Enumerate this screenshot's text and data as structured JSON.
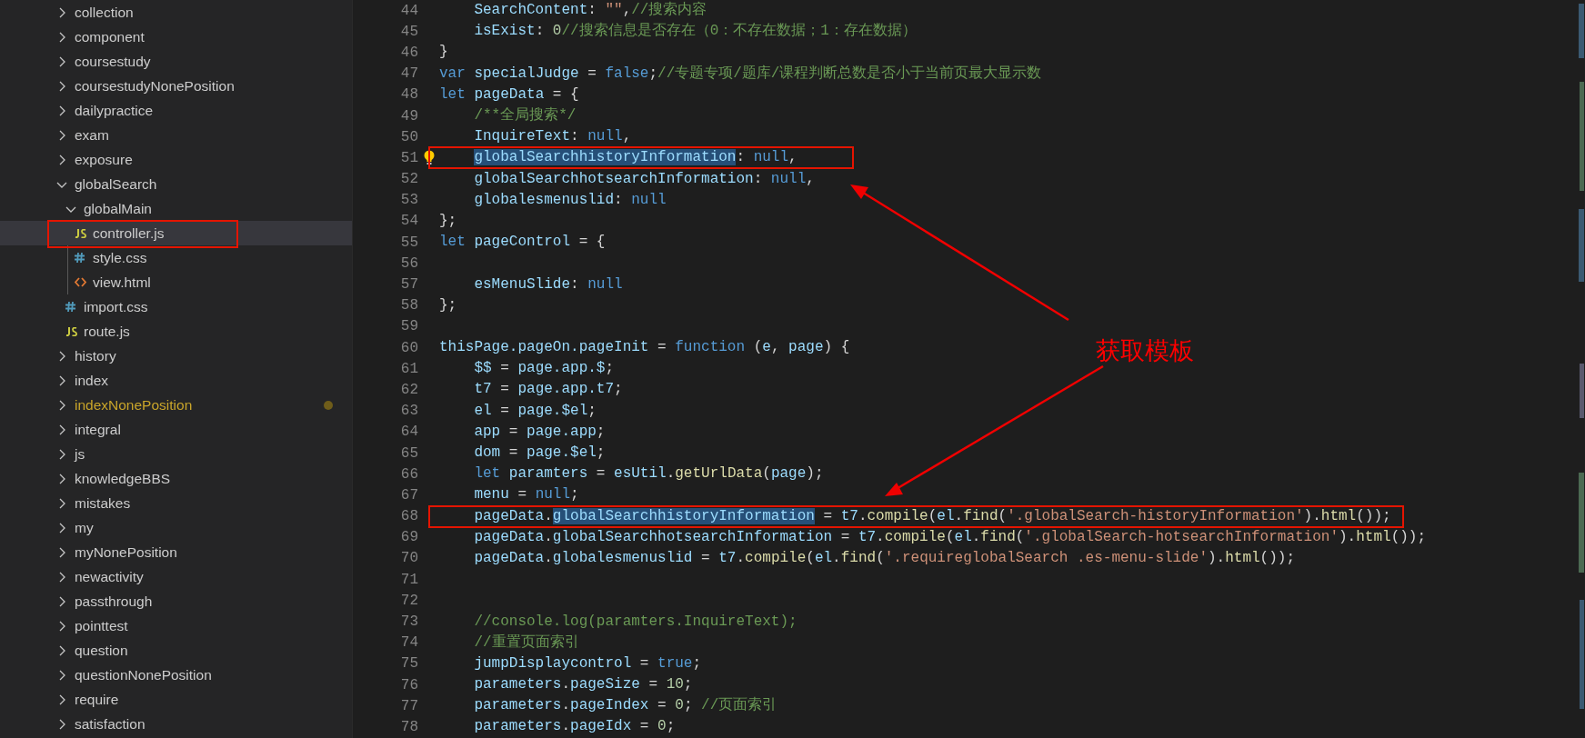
{
  "explorer": {
    "items": [
      {
        "label": "collection",
        "kind": "folder",
        "expanded": false,
        "selected": false
      },
      {
        "label": "component",
        "kind": "folder",
        "expanded": false,
        "selected": false
      },
      {
        "label": "coursestudy",
        "kind": "folder",
        "expanded": false,
        "selected": false
      },
      {
        "label": "coursestudyNonePosition",
        "kind": "folder",
        "expanded": false,
        "selected": false
      },
      {
        "label": "dailypractice",
        "kind": "folder",
        "expanded": false,
        "selected": false
      },
      {
        "label": "exam",
        "kind": "folder",
        "expanded": false,
        "selected": false
      },
      {
        "label": "exposure",
        "kind": "folder",
        "expanded": false,
        "selected": false
      },
      {
        "label": "globalSearch",
        "kind": "folder",
        "expanded": true,
        "selected": false,
        "children": [
          {
            "label": "globalMain",
            "kind": "folder",
            "expanded": true,
            "selected": false,
            "children": [
              {
                "label": "controller.js",
                "kind": "js",
                "selected": true,
                "boxed": true
              },
              {
                "label": "style.css",
                "kind": "css",
                "selected": false
              },
              {
                "label": "view.html",
                "kind": "html",
                "selected": false
              }
            ]
          },
          {
            "label": "import.css",
            "kind": "css",
            "selected": false
          },
          {
            "label": "route.js",
            "kind": "js",
            "selected": false
          }
        ]
      },
      {
        "label": "history",
        "kind": "folder",
        "expanded": false,
        "selected": false
      },
      {
        "label": "index",
        "kind": "folder",
        "expanded": false,
        "selected": false
      },
      {
        "label": "indexNonePosition",
        "kind": "folder",
        "expanded": false,
        "selected": false,
        "modified": true
      },
      {
        "label": "integral",
        "kind": "folder",
        "expanded": false,
        "selected": false
      },
      {
        "label": "js",
        "kind": "folder",
        "expanded": false,
        "selected": false
      },
      {
        "label": "knowledgeBBS",
        "kind": "folder",
        "expanded": false,
        "selected": false
      },
      {
        "label": "mistakes",
        "kind": "folder",
        "expanded": false,
        "selected": false
      },
      {
        "label": "my",
        "kind": "folder",
        "expanded": false,
        "selected": false
      },
      {
        "label": "myNonePosition",
        "kind": "folder",
        "expanded": false,
        "selected": false
      },
      {
        "label": "newactivity",
        "kind": "folder",
        "expanded": false,
        "selected": false
      },
      {
        "label": "passthrough",
        "kind": "folder",
        "expanded": false,
        "selected": false
      },
      {
        "label": "pointtest",
        "kind": "folder",
        "expanded": false,
        "selected": false
      },
      {
        "label": "question",
        "kind": "folder",
        "expanded": false,
        "selected": false
      },
      {
        "label": "questionNonePosition",
        "kind": "folder",
        "expanded": false,
        "selected": false
      },
      {
        "label": "require",
        "kind": "folder",
        "expanded": false,
        "selected": false
      },
      {
        "label": "satisfaction",
        "kind": "folder",
        "expanded": false,
        "selected": false
      }
    ]
  },
  "editor": {
    "lines": [
      {
        "n": "44",
        "tokens": [
          {
            "t": "    SearchContent",
            "kind": "var"
          },
          {
            "t": ": ",
            "kind": "pl"
          },
          {
            "t": "\"\"",
            "kind": "str"
          },
          {
            "t": ",",
            "kind": "pl"
          },
          {
            "t": "//搜索内容",
            "kind": "cmt"
          }
        ]
      },
      {
        "n": "45",
        "tokens": [
          {
            "t": "    isExist",
            "kind": "var"
          },
          {
            "t": ": ",
            "kind": "pl"
          },
          {
            "t": "0",
            "kind": "num"
          },
          {
            "t": "//搜索信息是否存在（0：不存在数据；1：存在数据）",
            "kind": "cmt"
          }
        ]
      },
      {
        "n": "46",
        "tokens": [
          {
            "t": "}",
            "kind": "pl"
          }
        ]
      },
      {
        "n": "47",
        "tokens": [
          {
            "t": "var",
            "kind": "kw"
          },
          {
            "t": " specialJudge ",
            "kind": "var"
          },
          {
            "t": "= ",
            "kind": "pl"
          },
          {
            "t": "false",
            "kind": "kw"
          },
          {
            "t": ";",
            "kind": "pl"
          },
          {
            "t": "//专题专项/题库/课程判断总数是否小于当前页最大显示数",
            "kind": "cmt"
          }
        ]
      },
      {
        "n": "48",
        "tokens": [
          {
            "t": "let",
            "kind": "kw"
          },
          {
            "t": " pageData ",
            "kind": "var"
          },
          {
            "t": "= {",
            "kind": "pl"
          }
        ]
      },
      {
        "n": "49",
        "tokens": [
          {
            "t": "    /**全局搜索*/",
            "kind": "cmt"
          }
        ]
      },
      {
        "n": "50",
        "tokens": [
          {
            "t": "    InquireText",
            "kind": "var"
          },
          {
            "t": ": ",
            "kind": "pl"
          },
          {
            "t": "null",
            "kind": "kw"
          },
          {
            "t": ",",
            "kind": "pl"
          }
        ]
      },
      {
        "n": "51",
        "lightbulb": true,
        "boxed": true,
        "tokens": [
          {
            "t": "    globalSearchhistoryInformation",
            "kind": "sel"
          },
          {
            "t": ": ",
            "kind": "pl"
          },
          {
            "t": "null",
            "kind": "kw"
          },
          {
            "t": ",",
            "kind": "pl"
          }
        ]
      },
      {
        "n": "52",
        "tokens": [
          {
            "t": "    globalSearchhotsearchInformation",
            "kind": "var"
          },
          {
            "t": ": ",
            "kind": "pl"
          },
          {
            "t": "null",
            "kind": "kw"
          },
          {
            "t": ",",
            "kind": "pl"
          }
        ]
      },
      {
        "n": "53",
        "tokens": [
          {
            "t": "    globalesmenuslid",
            "kind": "var"
          },
          {
            "t": ": ",
            "kind": "pl"
          },
          {
            "t": "null",
            "kind": "kw"
          }
        ]
      },
      {
        "n": "54",
        "tokens": [
          {
            "t": "};",
            "kind": "pl"
          }
        ]
      },
      {
        "n": "55",
        "tokens": [
          {
            "t": "let",
            "kind": "kw"
          },
          {
            "t": " pageControl ",
            "kind": "var"
          },
          {
            "t": "= {",
            "kind": "pl"
          }
        ]
      },
      {
        "n": "56"
      },
      {
        "n": "57",
        "tokens": [
          {
            "t": "    esMenuSlide",
            "kind": "var"
          },
          {
            "t": ": ",
            "kind": "pl"
          },
          {
            "t": "null",
            "kind": "kw"
          }
        ]
      },
      {
        "n": "58",
        "tokens": [
          {
            "t": "};",
            "kind": "pl"
          }
        ]
      },
      {
        "n": "59"
      },
      {
        "n": "60",
        "tokens": [
          {
            "t": "thisPage.pageOn.pageInit",
            "kind": "var"
          },
          {
            "t": " = ",
            "kind": "pl"
          },
          {
            "t": "function",
            "kind": "kw"
          },
          {
            "t": " (",
            "kind": "pl"
          },
          {
            "t": "e",
            "kind": "var"
          },
          {
            "t": ", ",
            "kind": "pl"
          },
          {
            "t": "page",
            "kind": "var"
          },
          {
            "t": ") {",
            "kind": "pl"
          }
        ]
      },
      {
        "n": "61",
        "tokens": [
          {
            "t": "    $$",
            "kind": "var"
          },
          {
            "t": " = ",
            "kind": "pl"
          },
          {
            "t": "page.app.$",
            "kind": "var"
          },
          {
            "t": ";",
            "kind": "pl"
          }
        ]
      },
      {
        "n": "62",
        "tokens": [
          {
            "t": "    t7",
            "kind": "var"
          },
          {
            "t": " = ",
            "kind": "pl"
          },
          {
            "t": "page.app.t7",
            "kind": "var"
          },
          {
            "t": ";",
            "kind": "pl"
          }
        ]
      },
      {
        "n": "63",
        "tokens": [
          {
            "t": "    el",
            "kind": "var"
          },
          {
            "t": " = ",
            "kind": "pl"
          },
          {
            "t": "page.$el",
            "kind": "var"
          },
          {
            "t": ";",
            "kind": "pl"
          }
        ]
      },
      {
        "n": "64",
        "tokens": [
          {
            "t": "    app",
            "kind": "var"
          },
          {
            "t": " = ",
            "kind": "pl"
          },
          {
            "t": "page.app",
            "kind": "var"
          },
          {
            "t": ";",
            "kind": "pl"
          }
        ]
      },
      {
        "n": "65",
        "tokens": [
          {
            "t": "    dom",
            "kind": "var"
          },
          {
            "t": " = ",
            "kind": "pl"
          },
          {
            "t": "page.$el",
            "kind": "var"
          },
          {
            "t": ";",
            "kind": "pl"
          }
        ]
      },
      {
        "n": "66",
        "tokens": [
          {
            "t": "    let",
            "kind": "kw"
          },
          {
            "t": " paramters",
            "kind": "var"
          },
          {
            "t": " = ",
            "kind": "pl"
          },
          {
            "t": "esUtil",
            "kind": "var"
          },
          {
            "t": ".",
            "kind": "pl"
          },
          {
            "t": "getUrlData",
            "kind": "fn"
          },
          {
            "t": "(",
            "kind": "pl"
          },
          {
            "t": "page",
            "kind": "var"
          },
          {
            "t": ");",
            "kind": "pl"
          }
        ]
      },
      {
        "n": "67",
        "tokens": [
          {
            "t": "    menu",
            "kind": "var"
          },
          {
            "t": " = ",
            "kind": "pl"
          },
          {
            "t": "null",
            "kind": "kw"
          },
          {
            "t": ";",
            "kind": "pl"
          }
        ]
      },
      {
        "n": "68",
        "boxed": true,
        "tokens": [
          {
            "t": "    pageData",
            "kind": "var"
          },
          {
            "t": ".",
            "kind": "pl"
          },
          {
            "t": "globalSearchhistoryInformation",
            "kind": "sel"
          },
          {
            "t": " = ",
            "kind": "pl"
          },
          {
            "t": "t7",
            "kind": "var"
          },
          {
            "t": ".",
            "kind": "pl"
          },
          {
            "t": "compile",
            "kind": "fn"
          },
          {
            "t": "(",
            "kind": "pl"
          },
          {
            "t": "el",
            "kind": "var"
          },
          {
            "t": ".",
            "kind": "pl"
          },
          {
            "t": "find",
            "kind": "fn"
          },
          {
            "t": "(",
            "kind": "pl"
          },
          {
            "t": "'.globalSearch-historyInformation'",
            "kind": "str"
          },
          {
            "t": ").",
            "kind": "pl"
          },
          {
            "t": "html",
            "kind": "fn"
          },
          {
            "t": "());",
            "kind": "pl"
          }
        ]
      },
      {
        "n": "69",
        "tokens": [
          {
            "t": "    pageData",
            "kind": "var"
          },
          {
            "t": ".",
            "kind": "pl"
          },
          {
            "t": "globalSearchhotsearchInformation",
            "kind": "var"
          },
          {
            "t": " = ",
            "kind": "pl"
          },
          {
            "t": "t7",
            "kind": "var"
          },
          {
            "t": ".",
            "kind": "pl"
          },
          {
            "t": "compile",
            "kind": "fn"
          },
          {
            "t": "(",
            "kind": "pl"
          },
          {
            "t": "el",
            "kind": "var"
          },
          {
            "t": ".",
            "kind": "pl"
          },
          {
            "t": "find",
            "kind": "fn"
          },
          {
            "t": "(",
            "kind": "pl"
          },
          {
            "t": "'.globalSearch-hotsearchInformation'",
            "kind": "str"
          },
          {
            "t": ").",
            "kind": "pl"
          },
          {
            "t": "html",
            "kind": "fn"
          },
          {
            "t": "());",
            "kind": "pl"
          }
        ]
      },
      {
        "n": "70",
        "tokens": [
          {
            "t": "    pageData",
            "kind": "var"
          },
          {
            "t": ".",
            "kind": "pl"
          },
          {
            "t": "globalesmenuslid",
            "kind": "var"
          },
          {
            "t": " = ",
            "kind": "pl"
          },
          {
            "t": "t7",
            "kind": "var"
          },
          {
            "t": ".",
            "kind": "pl"
          },
          {
            "t": "compile",
            "kind": "fn"
          },
          {
            "t": "(",
            "kind": "pl"
          },
          {
            "t": "el",
            "kind": "var"
          },
          {
            "t": ".",
            "kind": "pl"
          },
          {
            "t": "find",
            "kind": "fn"
          },
          {
            "t": "(",
            "kind": "pl"
          },
          {
            "t": "'.requireglobalSearch .es-menu-slide'",
            "kind": "str"
          },
          {
            "t": ").",
            "kind": "pl"
          },
          {
            "t": "html",
            "kind": "fn"
          },
          {
            "t": "());",
            "kind": "pl"
          }
        ]
      },
      {
        "n": "71"
      },
      {
        "n": "72"
      },
      {
        "n": "73",
        "tokens": [
          {
            "t": "    //console.log(paramters.InquireText);",
            "kind": "cmt"
          }
        ]
      },
      {
        "n": "74",
        "tokens": [
          {
            "t": "    //重置页面索引",
            "kind": "cmt"
          }
        ]
      },
      {
        "n": "75",
        "tokens": [
          {
            "t": "    jumpDisplaycontrol",
            "kind": "var"
          },
          {
            "t": " = ",
            "kind": "pl"
          },
          {
            "t": "true",
            "kind": "kw"
          },
          {
            "t": ";",
            "kind": "pl"
          }
        ]
      },
      {
        "n": "76",
        "tokens": [
          {
            "t": "    parameters",
            "kind": "var"
          },
          {
            "t": ".",
            "kind": "pl"
          },
          {
            "t": "pageSize",
            "kind": "var"
          },
          {
            "t": " = ",
            "kind": "pl"
          },
          {
            "t": "10",
            "kind": "num"
          },
          {
            "t": ";",
            "kind": "pl"
          }
        ]
      },
      {
        "n": "77",
        "tokens": [
          {
            "t": "    parameters",
            "kind": "var"
          },
          {
            "t": ".",
            "kind": "pl"
          },
          {
            "t": "pageIndex",
            "kind": "var"
          },
          {
            "t": " = ",
            "kind": "pl"
          },
          {
            "t": "0",
            "kind": "num"
          },
          {
            "t": "; ",
            "kind": "pl"
          },
          {
            "t": "//页面索引",
            "kind": "cmt"
          }
        ]
      },
      {
        "n": "78",
        "tokens": [
          {
            "t": "    parameters",
            "kind": "var"
          },
          {
            "t": ".",
            "kind": "pl"
          },
          {
            "t": "pageIdx",
            "kind": "var"
          },
          {
            "t": " = ",
            "kind": "pl"
          },
          {
            "t": "0",
            "kind": "num"
          },
          {
            "t": ";",
            "kind": "pl"
          }
        ]
      }
    ]
  },
  "annotation": {
    "label": "获取模板"
  }
}
